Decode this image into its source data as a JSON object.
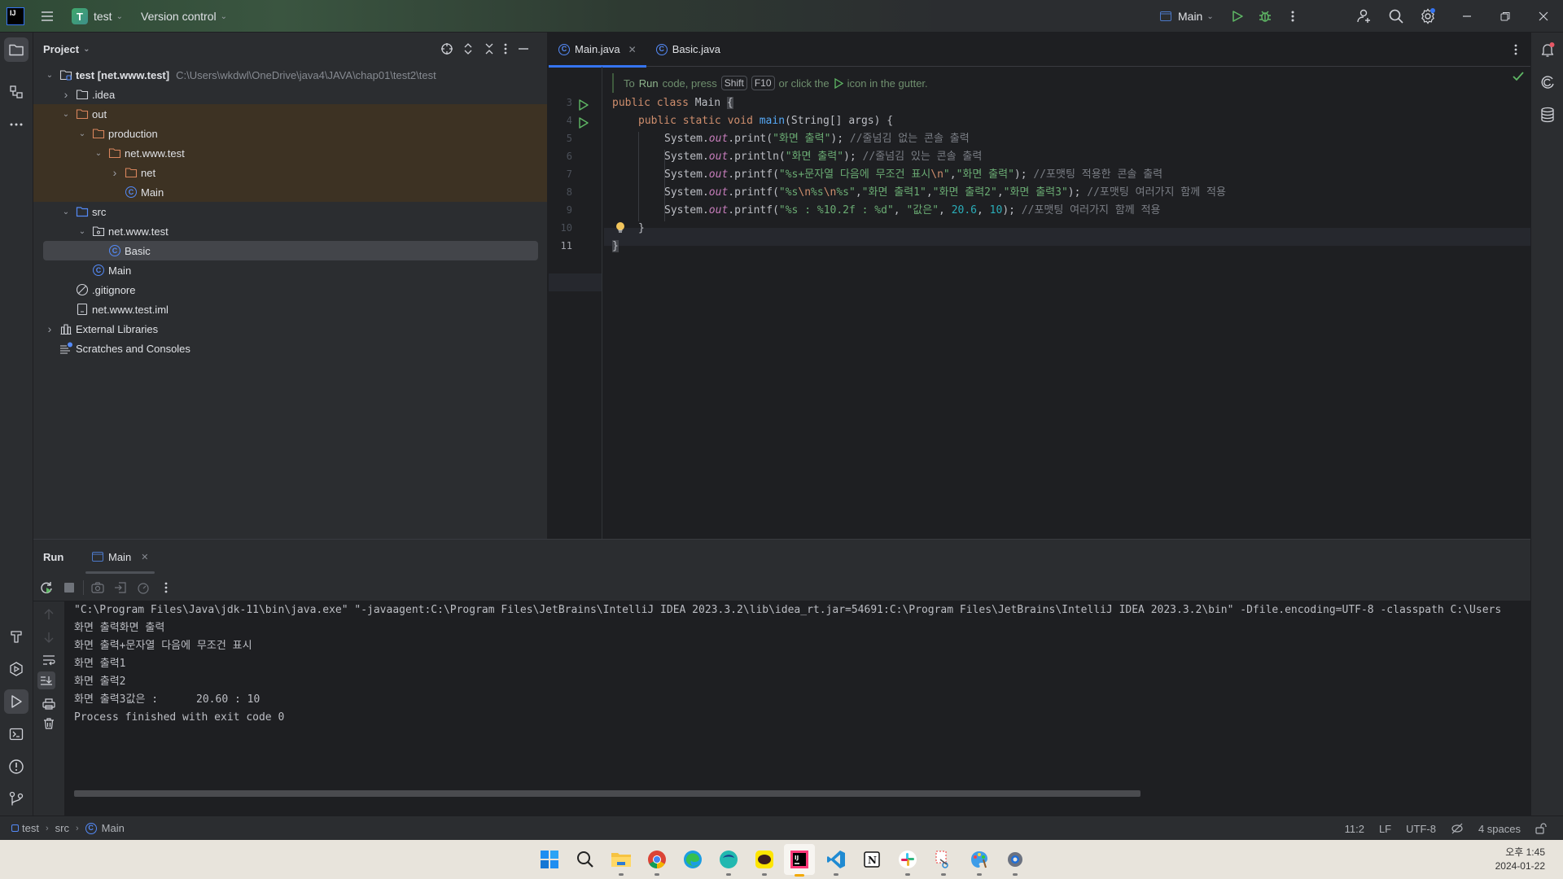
{
  "titlebar": {
    "project_badge": "T",
    "project_name": "test",
    "vcs_label": "Version control",
    "run_config": "Main"
  },
  "project_panel": {
    "title": "Project",
    "tree": [
      {
        "label": "test [net.www.test]",
        "hint": "C:\\Users\\wkdwl\\OneDrive\\java4\\JAVA\\chap01\\test2\\test",
        "depth": 0,
        "toggle": "expanded",
        "icon": "module-folder"
      },
      {
        "label": ".idea",
        "depth": 1,
        "toggle": "collapsed",
        "icon": "folder"
      },
      {
        "label": "out",
        "depth": 1,
        "toggle": "expanded",
        "icon": "folder-excluded"
      },
      {
        "label": "production",
        "depth": 2,
        "toggle": "expanded",
        "icon": "folder-excluded"
      },
      {
        "label": "net.www.test",
        "depth": 3,
        "toggle": "expanded",
        "icon": "folder-excluded"
      },
      {
        "label": "net",
        "depth": 4,
        "toggle": "collapsed",
        "icon": "folder-excluded"
      },
      {
        "label": "Main",
        "depth": 4,
        "toggle": "none",
        "icon": "class"
      },
      {
        "label": "src",
        "depth": 1,
        "toggle": "expanded",
        "icon": "source-folder"
      },
      {
        "label": "net.www.test",
        "depth": 2,
        "toggle": "expanded",
        "icon": "package"
      },
      {
        "label": "Basic",
        "depth": 3,
        "toggle": "none",
        "icon": "class",
        "selected": true
      },
      {
        "label": "Main",
        "depth": 2,
        "toggle": "none",
        "icon": "class"
      },
      {
        "label": ".gitignore",
        "depth": 1,
        "toggle": "none",
        "icon": "ignore-file"
      },
      {
        "label": "net.www.test.iml",
        "depth": 1,
        "toggle": "none",
        "icon": "iml-file"
      },
      {
        "label": "External Libraries",
        "depth": 0,
        "toggle": "collapsed",
        "icon": "libraries"
      },
      {
        "label": "Scratches and Consoles",
        "depth": 0,
        "toggle": "none",
        "icon": "scratches"
      }
    ]
  },
  "editor": {
    "tabs": [
      {
        "label": "Main.java",
        "active": true,
        "closable": true
      },
      {
        "label": "Basic.java",
        "active": false,
        "closable": false
      }
    ],
    "hint": {
      "prefix": "To",
      "run": "Run",
      "mid": "code, press",
      "key1": "Shift",
      "key2": "F10",
      "suffix1": "or click the",
      "suffix2": "icon in the gutter."
    },
    "line_numbers": [
      "3",
      "4",
      "5",
      "6",
      "7",
      "8",
      "9",
      "10",
      "11"
    ],
    "lines": {
      "l3": {
        "kw1": "public",
        "kw2": "class",
        "name": "Main",
        "brace": "{"
      },
      "l4": {
        "kw1": "public",
        "kw2": "static",
        "kw3": "void",
        "fn": "main",
        "rest": "(String[] args) {"
      },
      "l5": {
        "sys": "System.",
        "out": "out",
        "call": ".print(",
        "str": "\"화면 출력\"",
        "end": ");",
        "cmt": "//줄넘김 없는 콘솔 출력"
      },
      "l6": {
        "sys": "System.",
        "out": "out",
        "call": ".println(",
        "str": "\"화면 출력\"",
        "end": ");",
        "cmt": "//줄넘김 있는 콘솔 출력"
      },
      "l7": {
        "sys": "System.",
        "out": "out",
        "call": ".printf(",
        "str1": "\"%s+문자열 다음에 무조건 표시",
        "esc": "\\n",
        "str2": "\"",
        "comma": ",",
        "str3": "\"화면 출력\"",
        "end": ");",
        "cmt": "//포맷팅 적용한 콘솔 출력"
      },
      "l8": {
        "sys": "System.",
        "out": "out",
        "call": ".printf(",
        "s1": "\"%s",
        "e1": "\\n",
        "s2": "%s",
        "e2": "\\n",
        "s3": "%s\"",
        "c1": ",",
        "a1": "\"화면 출력1\"",
        "c2": ",",
        "a2": "\"화면 출력2\"",
        "c3": ",",
        "a3": "\"화면 출력3\"",
        "end": ");",
        "cmt": "//포맷팅 여러가지 함께 적용"
      },
      "l9": {
        "sys": "System.",
        "out": "out",
        "call": ".printf(",
        "str": "\"%s : %10.2f : %d\"",
        "c1": ", ",
        "arg": "\"값은\"",
        "c2": ", ",
        "n1": "20.6",
        "c3": ", ",
        "n2": "10",
        "end": ");",
        "cmt": "//포맷팅 여러가지 함께 적용"
      },
      "l10": {
        "text": "}"
      },
      "l11": {
        "text": "}"
      }
    }
  },
  "run_panel": {
    "title": "Run",
    "tab": "Main",
    "output": [
      "\"C:\\Program Files\\Java\\jdk-11\\bin\\java.exe\" \"-javaagent:C:\\Program Files\\JetBrains\\IntelliJ IDEA 2023.3.2\\lib\\idea_rt.jar=54691:C:\\Program Files\\JetBrains\\IntelliJ IDEA 2023.3.2\\bin\" -Dfile.encoding=UTF-8 -classpath C:\\Users",
      "화면 출력화면 출력",
      "화면 출력+문자열 다음에 무조건 표시",
      "화면 출력1",
      "화면 출력2",
      "화면 출력3값은 :      20.60 : 10",
      "Process finished with exit code 0"
    ]
  },
  "statusbar": {
    "breadcrumbs": [
      "test",
      "src",
      "Main"
    ],
    "position": "11:2",
    "line_sep": "LF",
    "encoding": "UTF-8",
    "indent": "4 spaces"
  },
  "taskbar": {
    "apps": [
      "windows-start",
      "search",
      "file-explorer",
      "chrome",
      "edge",
      "whale-browser",
      "kakaotalk",
      "intellij-idea",
      "vscode",
      "notion",
      "slack",
      "snipping-tool",
      "paint",
      "settings"
    ],
    "time": "오후 1:45",
    "date": "2024-01-22"
  },
  "colors": {
    "accent": "#3574f0",
    "run_green": "#5fb865",
    "excluded_bg": "#3d3223"
  }
}
